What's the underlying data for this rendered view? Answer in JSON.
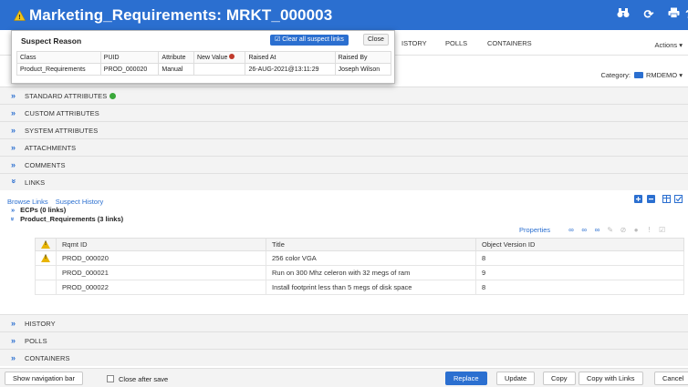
{
  "window": {
    "title": "Marketing_Requirements: MRKT_000003",
    "icons": [
      "binoculars-icon",
      "refresh-icon",
      "print-icon",
      "help-icon"
    ]
  },
  "tabs": [
    {
      "label": "ISTORY"
    },
    {
      "label": "POLLS"
    },
    {
      "label": "CONTAINERS"
    }
  ],
  "actions_label": "Actions",
  "category": {
    "label": "Category:",
    "value": "RMDEMO"
  },
  "suspect_popup": {
    "title": "Suspect Reason",
    "clear_label": "Clear all suspect links",
    "close_label": "Close",
    "columns": [
      "Class",
      "PUID",
      "Attribute",
      "New Value",
      "Raised At",
      "Raised By"
    ],
    "rows": [
      [
        "Product_Requirements",
        "PROD_000020",
        "Manual",
        "",
        "26-AUG-2021@13:11:29",
        "Joseph Wilson"
      ]
    ]
  },
  "sections_top": [
    {
      "label": "STANDARD ATTRIBUTES"
    },
    {
      "label": "CUSTOM ATTRIBUTES"
    },
    {
      "label": "SYSTEM ATTRIBUTES"
    },
    {
      "label": "ATTACHMENTS"
    },
    {
      "label": "COMMENTS"
    },
    {
      "label": "LINKS"
    }
  ],
  "links": {
    "browse_label": "Browse Links",
    "suspect_history_label": "Suspect History",
    "ecps_label": "ECPs (0 links)",
    "product_label": "Product_Requirements (3 links)",
    "properties_label": "Properties",
    "columns": [
      "Rqmt ID",
      "Title",
      "Object Version ID"
    ],
    "rows": [
      {
        "id": "PROD_000020",
        "title": "256 color VGA",
        "version": "8",
        "warning": true
      },
      {
        "id": "PROD_000021",
        "title": "Run on 300 Mhz celeron with 32 megs of ram",
        "version": "9",
        "warning": false
      },
      {
        "id": "PROD_000022",
        "title": "Install footprint less than 5 megs of disk space",
        "version": "8",
        "warning": false
      }
    ]
  },
  "sections_bottom": [
    {
      "label": "HISTORY"
    },
    {
      "label": "POLLS"
    },
    {
      "label": "CONTAINERS"
    }
  ],
  "footer": {
    "show_nav": "Show navigation bar",
    "close_after_save": "Close after save",
    "replace": "Replace",
    "update": "Update",
    "copy": "Copy",
    "copy_with_links": "Copy with Links",
    "cancel": "Cancel"
  },
  "colors": {
    "accent": "#2b6fd0",
    "warning": "#e8b400",
    "ok": "#3aa83a"
  }
}
